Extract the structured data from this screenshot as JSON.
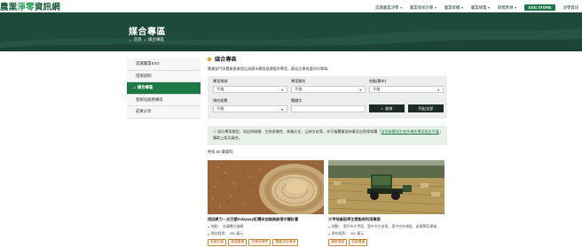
{
  "header": {
    "logo_prefix": "農業",
    "logo_highlight": "淨零",
    "logo_suffix": "資訊網",
    "nav": [
      {
        "label": "認識農業淨零",
        "caret": true
      },
      {
        "label": "農業碳排計算",
        "caret": true
      },
      {
        "label": "農業碳權",
        "caret": true
      },
      {
        "label": "農業綠電",
        "caret": true
      },
      {
        "label": "碳標準規",
        "caret": true
      }
    ],
    "esg_label": "ESG STORE",
    "nav_last": "淨零資訊"
  },
  "banner": {
    "title": "媒合專區",
    "breadcrumb_home": "首頁",
    "breadcrumb_sep": "/",
    "breadcrumb_current": "媒合專區"
  },
  "sidebar": {
    "items": [
      {
        "label": "認識農業ESG",
        "active": false
      },
      {
        "label": "措施說明",
        "active": false
      },
      {
        "label": "媒合專區",
        "active": true
      },
      {
        "label": "客製化服務專區",
        "active": false
      },
      {
        "label": "成果分享",
        "active": false
      }
    ]
  },
  "main": {
    "title": "媒合專區",
    "desc": "農業部門與農業產業提出具備永續發展價值的專案，歡迎企業挑選合作場域。",
    "filters": {
      "field_label": "專案領域",
      "field_value": "不限",
      "type_label": "專案類別",
      "type_value": "不限",
      "region_label": "地點(縣市)",
      "region_value": "不限",
      "budget_label": "預估經費",
      "budget_value": "不限",
      "keyword_label": "關鍵字",
      "keyword_value": "",
      "search_label": "查詢",
      "all_label": "列出全部"
    },
    "notice_text1": "部分專案類型，如自然碳匯、生物多樣性、林業文化、山林文化等，亦可福農業部林業及自然保育署「",
    "notice_link": "自然碳匯與生物多樣性專案媒合平臺",
    "notice_text2": "」獲取上架及媒合。",
    "count_text": "共有 50 筆資料",
    "cards": [
      {
        "title": "找回原力－太巴塱Kalapaay紅糯米加強與部落守護計畫",
        "location_label": "地點：",
        "location": "花蓮縣光復鄉",
        "budget_label": "預估經費：",
        "budget": "450 萬元",
        "tags": [
          "長期方案",
          "部落產業",
          "生物多樣性",
          "農業文化傳承"
        ]
      },
      {
        "title": "大甲地區稻草生質能再利用專案",
        "location_label": "地點：",
        "location": "臺中市大甲區、臺中市大安區、臺中市外埔區、苗栗縣苑裡鎮",
        "budget_label": "預估經費：",
        "budget": "300 萬元",
        "tags": [
          "減碳專案",
          "低碳農業"
        ]
      }
    ]
  },
  "colors": {
    "brand_green": "#1d7a47",
    "banner_dark": "#1f4a3a",
    "accent_orange": "#e8a21a"
  }
}
